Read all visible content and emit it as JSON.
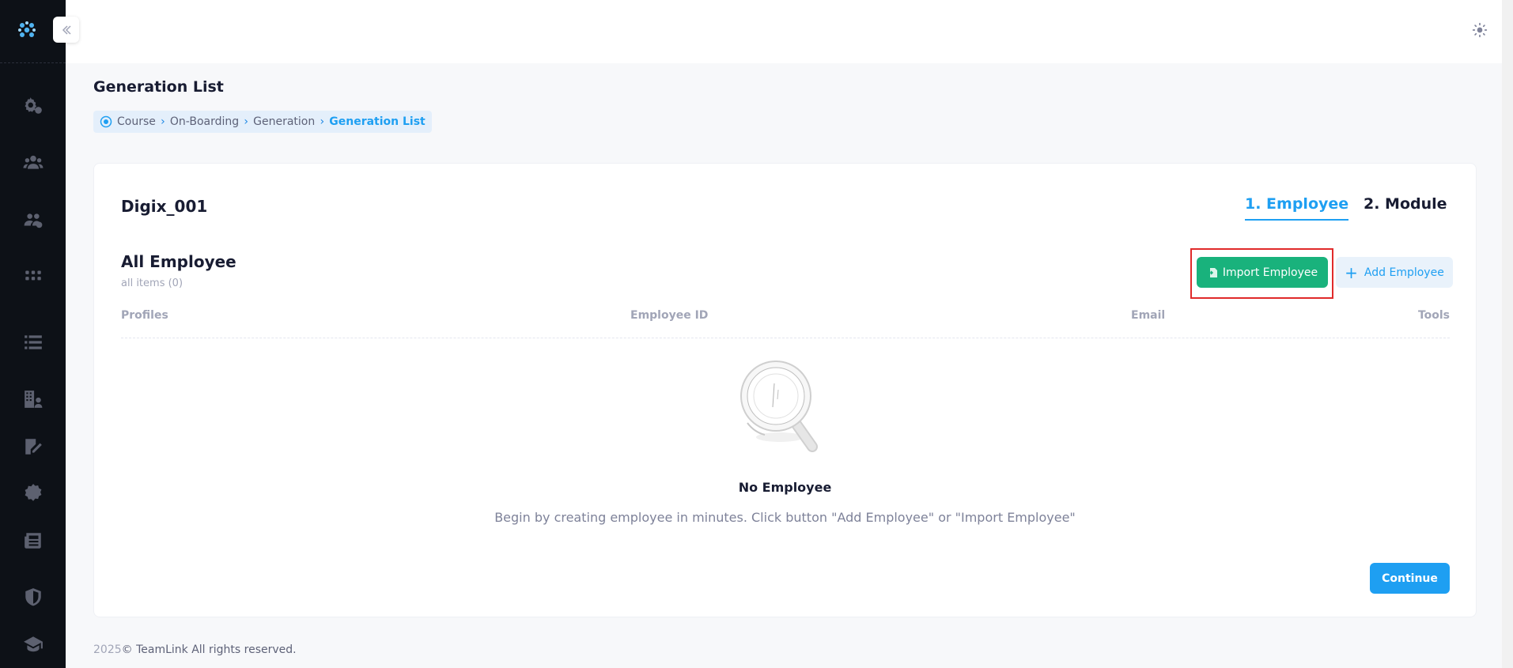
{
  "page": {
    "title": "Generation List"
  },
  "breadcrumb": [
    "Course",
    "On-Boarding",
    "Generation",
    "Generation List"
  ],
  "card": {
    "title": "Digix_001",
    "tabs": [
      "1. Employee",
      "2. Module"
    ],
    "section_title": "All Employee",
    "section_sub": "all items (0)",
    "import_button": "Import Employee",
    "add_button": "Add Employee",
    "columns": [
      "Profiles",
      "Employee ID",
      "Email",
      "Tools"
    ],
    "empty_title": "No Employee",
    "empty_desc": "Begin by creating employee in minutes. Click button \"Add Employee\" or \"Import Employee\"",
    "continue_button": "Continue"
  },
  "footer": {
    "year": "2025",
    "text": "© TeamLink All rights reserved."
  },
  "sidebar_icons": [
    "settings-icon",
    "users-icon",
    "user-group-icon",
    "apps-icon",
    "list-icon",
    "building-user-icon",
    "signature-icon",
    "certificate-icon",
    "news-icon",
    "shield-icon",
    "graduation-cap-icon"
  ],
  "colors": {
    "accent": "#1e9ff2",
    "success": "#19b27c",
    "sidebar_bg": "#0d1117",
    "highlight": "#e02b2b"
  }
}
